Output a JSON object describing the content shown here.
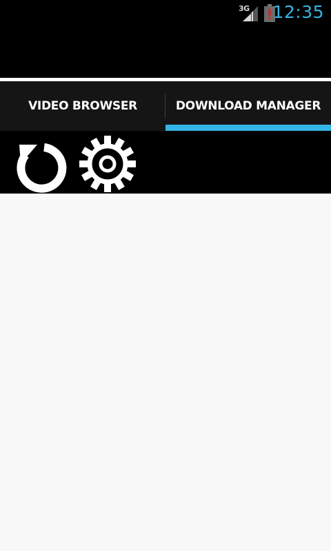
{
  "status_bar": {
    "network": "3G",
    "time": "12:35",
    "signal_icon": "signal-icon",
    "battery_icon": "battery-low-icon",
    "accent_color": "#33b5e5"
  },
  "tabs": [
    {
      "label": "VIDEO BROWSER",
      "selected": false
    },
    {
      "label": "DOWNLOAD MANAGER",
      "selected": true
    }
  ],
  "toolbar": {
    "buttons": [
      {
        "icon": "refresh-icon"
      },
      {
        "icon": "gear-icon"
      }
    ]
  },
  "colors": {
    "tab_bar": "#151515",
    "indicator": "#33b5e5",
    "content_bg": "#f8f8f8"
  }
}
